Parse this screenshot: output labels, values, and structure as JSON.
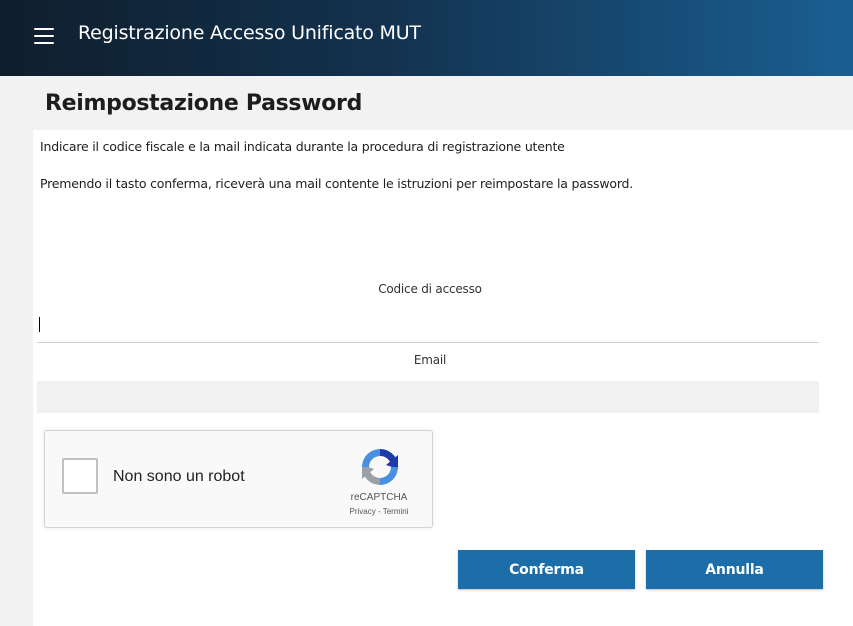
{
  "header": {
    "title": "Registrazione Accesso Unificato MUT",
    "menu_icon": "hamburger-menu-icon"
  },
  "page": {
    "title": "Reimpostazione Password",
    "intro_line_1": "Indicare il codice fiscale e la mail indicata durante la procedura di registrazione utente",
    "intro_line_2": "Premendo il tasto conferma, riceverà una mail contente le istruzioni per reimpostare la password."
  },
  "form": {
    "code_label": "Codice di accesso",
    "code_value": "",
    "email_label": "Email",
    "email_value": ""
  },
  "recaptcha": {
    "label": "Non sono un robot",
    "brand": "reCAPTCHA",
    "privacy_link": "Privacy",
    "separator": " - ",
    "terms_link": "Termini",
    "checked": false
  },
  "actions": {
    "confirm_label": "Conferma",
    "cancel_label": "Annulla"
  },
  "colors": {
    "header_dark": "#0f1e2c",
    "header_light": "#1a5f92",
    "button": "#1c6ea8",
    "page_bg": "#f2f2f2"
  }
}
